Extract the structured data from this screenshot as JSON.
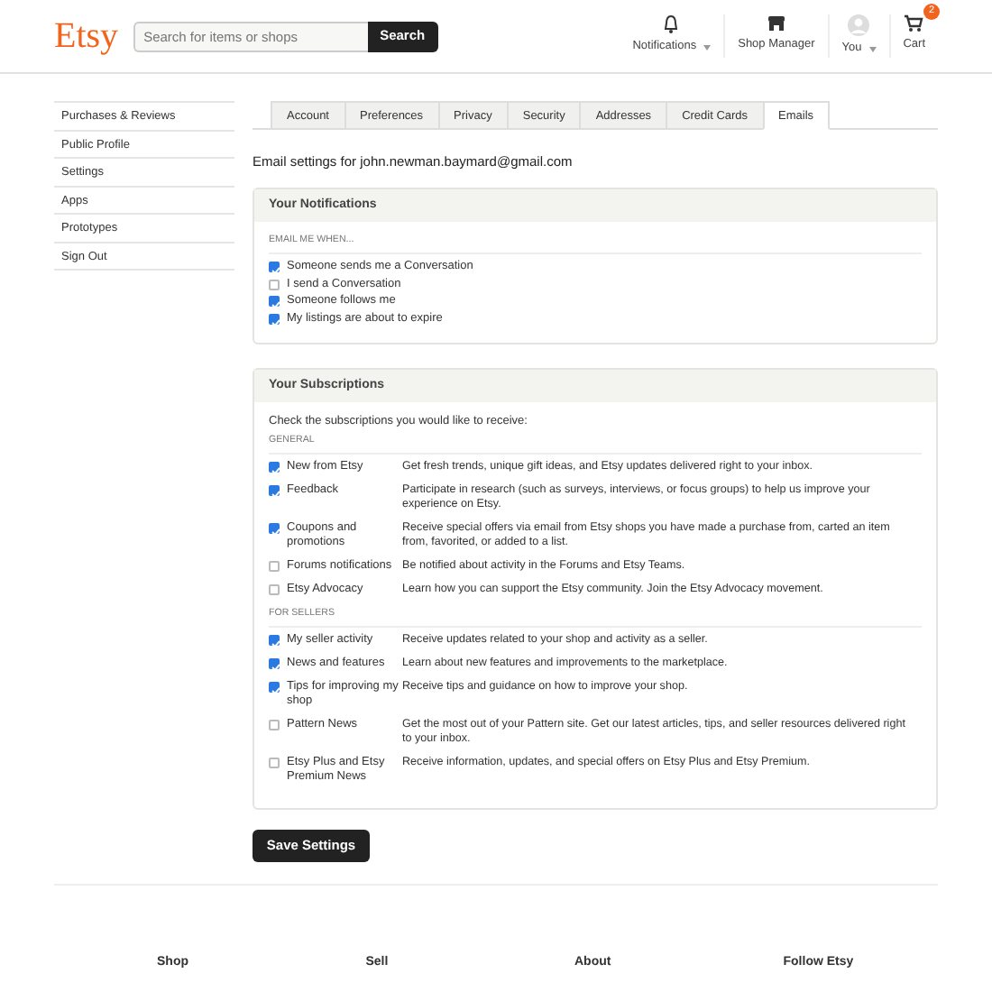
{
  "header": {
    "logo": "Etsy",
    "search": {
      "placeholder": "Search for items or shops",
      "button": "Search"
    },
    "nav": [
      {
        "kind": "bell",
        "label": "Notifications",
        "caret": true
      },
      {
        "kind": "shop",
        "label": "Shop Manager",
        "caret": false
      },
      {
        "kind": "avatar",
        "label": "You",
        "caret": true
      },
      {
        "kind": "cart",
        "label": "Cart",
        "caret": false,
        "badge": "2"
      }
    ]
  },
  "sidebar": {
    "items": [
      "Purchases & Reviews",
      "Public Profile",
      "Settings",
      "Apps",
      "Prototypes",
      "Sign Out"
    ]
  },
  "tabs": [
    {
      "label": "Account",
      "selected": false
    },
    {
      "label": "Preferences",
      "selected": false
    },
    {
      "label": "Privacy",
      "selected": false
    },
    {
      "label": "Security",
      "selected": false
    },
    {
      "label": "Addresses",
      "selected": false
    },
    {
      "label": "Credit Cards",
      "selected": false
    },
    {
      "label": "Emails",
      "selected": true
    }
  ],
  "intro": "Email settings for john.newman.baymard@gmail.com",
  "notifications": {
    "title": "Your Notifications",
    "group": "EMAIL ME WHEN...",
    "items": [
      {
        "label": "Someone sends me a Conversation",
        "checked": true
      },
      {
        "label": "I send a Conversation",
        "checked": false
      },
      {
        "label": "Someone follows me",
        "checked": true
      },
      {
        "label": "My listings are about to expire",
        "checked": true
      }
    ]
  },
  "subscriptions": {
    "title": "Your Subscriptions",
    "intro": "Check the subscriptions you would like to receive:",
    "groups": [
      {
        "title": "GENERAL",
        "items": [
          {
            "label": "New from Etsy",
            "description": "Get fresh trends, unique gift ideas, and Etsy updates delivered right to your inbox.",
            "checked": true
          },
          {
            "label": "Feedback",
            "description": "Participate in research (such as surveys, interviews, or focus groups) to help us improve your experience on Etsy.",
            "checked": true
          },
          {
            "label": "Coupons and promotions",
            "description": "Receive special offers via email from Etsy shops you have made a purchase from, carted an item from, favorited, or added to a list.",
            "checked": true
          },
          {
            "label": "Forums notifications",
            "description": "Be notified about activity in the Forums and Etsy Teams.",
            "checked": false
          },
          {
            "label": "Etsy Advocacy",
            "description": "Learn how you can support the Etsy community. Join the Etsy Advocacy movement.",
            "checked": false
          }
        ]
      },
      {
        "title": "FOR SELLERS",
        "items": [
          {
            "label": "My seller activity",
            "description": "Receive updates related to your shop and activity as a seller.",
            "checked": true
          },
          {
            "label": "News and features",
            "description": "Learn about new features and improvements to the marketplace.",
            "checked": true
          },
          {
            "label": "Tips for improving my shop",
            "description": "Receive tips and guidance on how to improve your shop.",
            "checked": true
          },
          {
            "label": "Pattern News",
            "description": "Get the most out of your Pattern site. Get our latest articles, tips, and seller resources delivered right to your inbox.",
            "checked": false
          },
          {
            "label": "Etsy Plus and Etsy Premium News",
            "description": "Receive information, updates, and special offers on Etsy Plus and Etsy Premium.",
            "checked": false
          }
        ]
      }
    ]
  },
  "save_button": "Save Settings",
  "footer": {
    "columns": [
      "Shop",
      "Sell",
      "About",
      "Follow Etsy"
    ]
  }
}
